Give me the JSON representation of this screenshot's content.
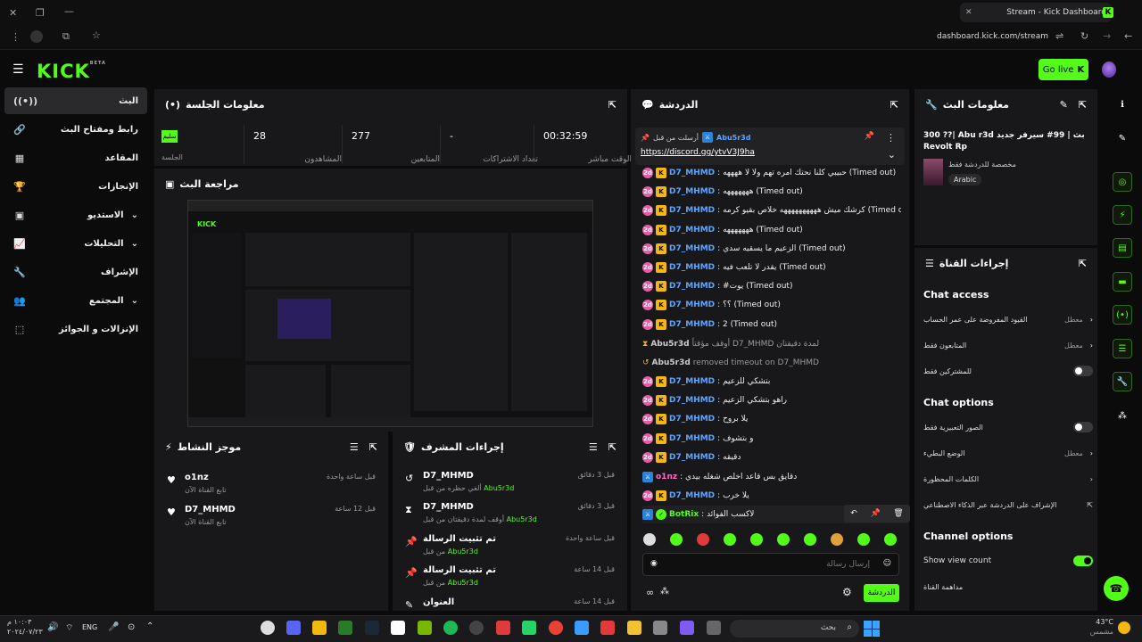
{
  "browser": {
    "tab_title": "Stream - Kick Dashboard",
    "url": "dashboard.kick.com/stream",
    "new_tab": "+"
  },
  "header": {
    "logo": "KICK",
    "logo_sup": "BETA",
    "go_live": "Go live"
  },
  "sidebar": {
    "items": [
      {
        "label": "البث",
        "icon": "broadcast-icon"
      },
      {
        "label": "رابط ومفتاح البث",
        "icon": "link-icon"
      },
      {
        "label": "المقاعد",
        "icon": "dashboard-icon"
      },
      {
        "label": "الإنجازات",
        "icon": "trophy-icon"
      },
      {
        "label": "الاستديو",
        "icon": "studio-icon"
      },
      {
        "label": "التحليلات",
        "icon": "analytics-icon"
      },
      {
        "label": "الإشراف",
        "icon": "wrench-icon"
      },
      {
        "label": "المجتمع",
        "icon": "community-icon"
      },
      {
        "label": "الإنزالات و الجوائز",
        "icon": "drops-icon"
      }
    ]
  },
  "session": {
    "title": "معلومات الجلسة",
    "status_badge": "سليم",
    "status_label": "الجلسة",
    "stats": [
      {
        "value": "28",
        "label": "المشاهدون"
      },
      {
        "value": "277",
        "label": "المتابعين"
      },
      {
        "value": "-",
        "label": "تعداد الاشتراكات"
      },
      {
        "value": "00:32:59",
        "label": "الوقت مباشر"
      }
    ]
  },
  "preview": {
    "title": "مراجعة البث"
  },
  "activity": {
    "title": "موجز النشاط",
    "items": [
      {
        "name": "o1nz",
        "sub": "تابع القناة الآن",
        "time": "قبل ساعة واحدة"
      },
      {
        "name": "D7_MHMD",
        "sub": "تابع القناة الآن",
        "time": "قبل 12 ساعة"
      }
    ]
  },
  "modactions": {
    "title": "إجراءات المشرف",
    "items": [
      {
        "name": "D7_MHMD",
        "sub": "ألغي حظره من قبل",
        "by": "Abu5r3d",
        "time": "قبل 3 دقائق"
      },
      {
        "name": "D7_MHMD",
        "sub": "أوقف لمدة دقيقتان من قبل",
        "by": "Abu5r3d",
        "time": "قبل 3 دقائق"
      },
      {
        "name": "تم تثبيت الرسالة",
        "sub": "من قبل",
        "by": "Abu5r3d",
        "time": "قبل ساعة واحدة"
      },
      {
        "name": "تم تثبيت الرسالة",
        "sub": "من قبل",
        "by": "Abu5r3d",
        "time": "قبل 14 ساعة"
      },
      {
        "name": "العنوان",
        "sub": "",
        "by": "",
        "time": "قبل 14 ساعة"
      }
    ]
  },
  "chat": {
    "title": "الدردشة",
    "pinned_by_label": "أرسلت من قبل",
    "pinned_user": "Abu5r3d",
    "pinned_link": "https://discord.gg/ytvV3J9ha",
    "messages": [
      {
        "user": "D7_MHMD",
        "text": ": حبيبي كلنا نحتك امره تهم ولا لا ههههه (Timed out)"
      },
      {
        "user": "D7_MHMD",
        "text": ": هههههههه (Timed out)"
      },
      {
        "user": "D7_MHMD",
        "text": ": كرشك ميش ههههههههههه خلاص بقيو كرمه (Timed out)"
      },
      {
        "user": "D7_MHMD",
        "text": ": هههههههه (Timed out)"
      },
      {
        "user": "D7_MHMD",
        "text": ": الزعيم ما يسقيه سدي (Timed out)"
      },
      {
        "user": "D7_MHMD",
        "text": ": يقدر لا تلعب فيه (Timed out)"
      },
      {
        "user": "D7_MHMD",
        "text": ": #يوت (Timed out)"
      },
      {
        "user": "D7_MHMD",
        "text": ": ؟؟ (Timed out)"
      },
      {
        "user": "D7_MHMD",
        "text": ": 2 (Timed out)"
      }
    ],
    "sys1_user": "Abu5r3d",
    "sys1_text": "أوقف مؤقتاً D7_MHMD لمدة دقيقتان",
    "sys2_user": "Abu5r3d",
    "sys2_text": "removed timeout on D7_MHMD",
    "messages2": [
      {
        "user": "D7_MHMD",
        "text": ": بتشكي للزعيم"
      },
      {
        "user": "D7_MHMD",
        "text": ": راهو بتشكي الزعيم"
      },
      {
        "user": "D7_MHMD",
        "text": ": يلا بروح"
      },
      {
        "user": "D7_MHMD",
        "text": ": و بتشوف"
      },
      {
        "user": "D7_MHMD",
        "text": ": دقيقه"
      }
    ],
    "o1nz_user": "o1nz",
    "o1nz_text": ": دقايق بس قاعد اخلص شغله بيدي",
    "last_user": "D7_MHMD",
    "last_text": ": يلا خرب",
    "bot_user": "BotRix",
    "bot_text": ": لاكسب الفوائد",
    "input_placeholder": "إرسال رسالة",
    "send_button": "الدردشة"
  },
  "stream_info": {
    "title": "معلومات البث",
    "stream_title": "300 ??| Abu r3d بث | 99# سيرفر جديد Revolt Rp",
    "mature_label": "مخصصة للدردشة فقط",
    "language": "Arabic"
  },
  "channel_actions": {
    "title": "إجراءات القناة",
    "chat_access": "Chat access",
    "access_rows": [
      {
        "label": "القيود المفروضة على عمر الحساب",
        "value": "معطل"
      },
      {
        "label": "المتابعون فقط",
        "value": "معطل"
      },
      {
        "label": "للمشتركين فقط",
        "value": ""
      }
    ],
    "chat_options": "Chat options",
    "option_rows": [
      {
        "label": "الصور التعبيرية فقط",
        "value": ""
      },
      {
        "label": "الوضع البطيء",
        "value": "معطل"
      },
      {
        "label": "الكلمات المحظورة",
        "value": ""
      },
      {
        "label": "الإشراف على الدردشة عبر الذكاء الاصطناعي",
        "value": ""
      }
    ],
    "channel_options": "Channel options",
    "show_view_count": "Show view count",
    "channel_watch": "مداهمة القناة"
  },
  "taskbar": {
    "time": "١٠:٠٣ م",
    "date": "٢٠٢٤/٠٧/٢٣",
    "lang": "ENG",
    "weather_temp": "43°C",
    "weather_text": "مشمس",
    "search": "بحث"
  }
}
